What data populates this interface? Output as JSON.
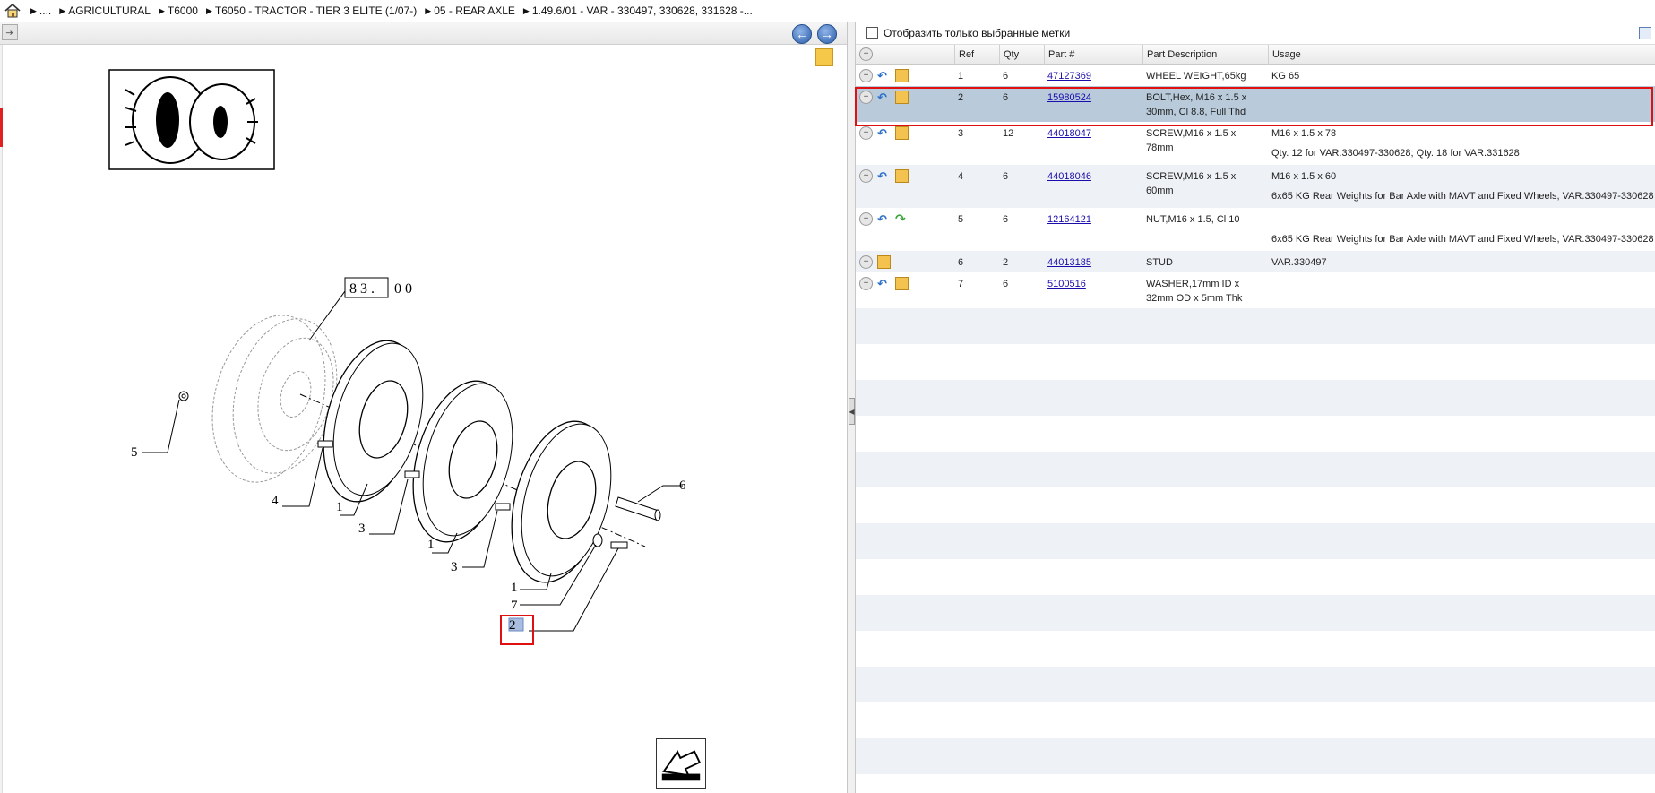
{
  "breadcrumb": {
    "items": [
      "....",
      "AGRICULTURAL",
      "T6000",
      "T6050 - TRACTOR - TIER 3 ELITE (1/07-)",
      "05 - REAR AXLE",
      "1.49.6/01 - VAR - 330497, 330628, 331628 -..."
    ]
  },
  "drawing": {
    "label_ref": "8 3 .",
    "label_suffix": "0 0",
    "callouts": [
      "1",
      "1",
      "1",
      "2",
      "3",
      "3",
      "4",
      "5",
      "6",
      "7"
    ]
  },
  "filter": {
    "label": "Отобразить только выбранные метки"
  },
  "table": {
    "headers": {
      "ref": "Ref",
      "qty": "Qty",
      "part": "Part #",
      "desc": "Part Description",
      "usage": "Usage"
    },
    "rows": [
      {
        "ref": "1",
        "qty": "6",
        "part": "47127369",
        "desc": "WHEEL WEIGHT,65kg",
        "usage": "KG 65",
        "note": ""
      },
      {
        "ref": "2",
        "qty": "6",
        "part": "15980524",
        "desc": "BOLT,Hex, M16 x 1.5 x 30mm, Cl 8.8, Full Thd",
        "usage": "",
        "note": ""
      },
      {
        "ref": "3",
        "qty": "12",
        "part": "44018047",
        "desc": "SCREW,M16 x 1.5 x 78mm",
        "usage": "M16 x 1.5 x 78",
        "note": "Qty. 12 for VAR.330497-330628; Qty. 18 for VAR.331628"
      },
      {
        "ref": "4",
        "qty": "6",
        "part": "44018046",
        "desc": "SCREW,M16 x 1.5 x 60mm",
        "usage": "M16 x 1.5 x 60",
        "note": "6x65 KG Rear Weights for Bar Axle with MAVT and Fixed Wheels, VAR.330497-330628"
      },
      {
        "ref": "5",
        "qty": "6",
        "part": "12164121",
        "desc": "NUT,M16 x 1.5, Cl 10",
        "usage": "",
        "note": "6x65 KG Rear Weights for Bar Axle with MAVT and Fixed Wheels, VAR.330497-330628"
      },
      {
        "ref": "6",
        "qty": "2",
        "part": "44013185",
        "desc": "STUD",
        "usage": "VAR.330497",
        "note": ""
      },
      {
        "ref": "7",
        "qty": "6",
        "part": "5100516",
        "desc": "WASHER,17mm ID x 32mm OD x 5mm Thk",
        "usage": "",
        "note": ""
      }
    ]
  },
  "colors": {
    "selected_row": "#b9cbdb",
    "alt_row": "#eef1f6",
    "highlight": "#e01010",
    "link": "#1a0dab"
  }
}
